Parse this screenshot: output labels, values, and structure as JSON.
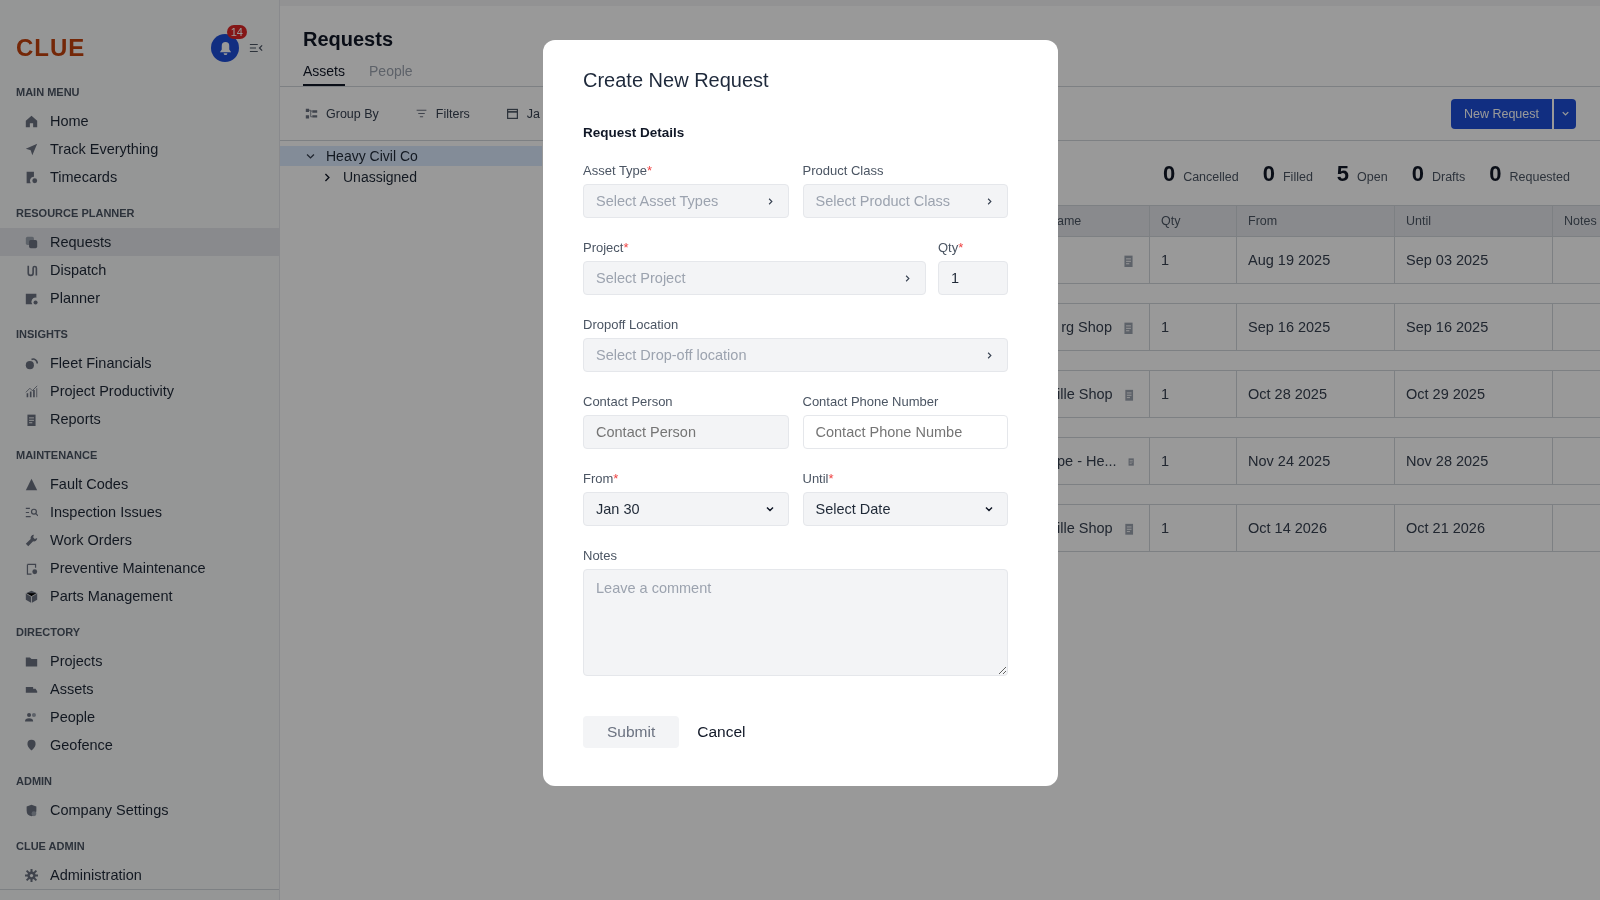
{
  "sidebar": {
    "logo": "CLUE",
    "notification_count": "14",
    "sections": [
      {
        "heading": "MAIN MENU",
        "items": [
          {
            "label": "Home",
            "selected": false
          },
          {
            "label": "Track Everything",
            "selected": false
          },
          {
            "label": "Timecards",
            "selected": false
          }
        ]
      },
      {
        "heading": "RESOURCE PLANNER",
        "items": [
          {
            "label": "Requests",
            "selected": true
          },
          {
            "label": "Dispatch",
            "selected": false
          },
          {
            "label": "Planner",
            "selected": false
          }
        ]
      },
      {
        "heading": "INSIGHTS",
        "items": [
          {
            "label": "Fleet Financials",
            "selected": false
          },
          {
            "label": "Project Productivity",
            "selected": false
          },
          {
            "label": "Reports",
            "selected": false
          }
        ]
      },
      {
        "heading": "MAINTENANCE",
        "items": [
          {
            "label": "Fault Codes",
            "selected": false
          },
          {
            "label": "Inspection Issues",
            "selected": false
          },
          {
            "label": "Work Orders",
            "selected": false
          },
          {
            "label": "Preventive Maintenance",
            "selected": false
          },
          {
            "label": "Parts Management",
            "selected": false
          }
        ]
      },
      {
        "heading": "DIRECTORY",
        "items": [
          {
            "label": "Projects",
            "selected": false
          },
          {
            "label": "Assets",
            "selected": false
          },
          {
            "label": "People",
            "selected": false
          },
          {
            "label": "Geofence",
            "selected": false
          }
        ]
      },
      {
        "heading": "ADMIN",
        "items": [
          {
            "label": "Company Settings",
            "selected": false
          }
        ]
      },
      {
        "heading": "CLUE ADMIN",
        "items": [
          {
            "label": "Administration",
            "selected": false
          }
        ]
      }
    ]
  },
  "page": {
    "title": "Requests",
    "tabs": [
      {
        "label": "Assets",
        "selected": true
      },
      {
        "label": "People",
        "selected": false
      }
    ],
    "toolbar": [
      "Group By",
      "Filters",
      "Ja"
    ],
    "primary_button": "New Request",
    "tree": [
      {
        "label": "Heavy Civil Co",
        "expanded": true,
        "children": [
          {
            "label": "Unassigned",
            "expanded": false
          }
        ]
      }
    ],
    "stats": [
      {
        "count": "0",
        "label": "Cancelled"
      },
      {
        "count": "0",
        "label": "Filled"
      },
      {
        "count": "5",
        "label": "Open"
      },
      {
        "count": "0",
        "label": "Drafts"
      },
      {
        "count": "0",
        "label": "Requested"
      }
    ],
    "table": {
      "columns": [
        "ame",
        "Qty",
        "From",
        "Until",
        "Notes"
      ],
      "rows": [
        {
          "qty": "1",
          "from": "Aug 19 2025",
          "until": "Sep 03 2025"
        },
        {
          "name": "rg Shop",
          "qty": "1",
          "from": "Sep 16 2025",
          "until": "Sep 16 2025"
        },
        {
          "name": "ille Shop",
          "qty": "1",
          "from": "Oct 28 2025",
          "until": "Oct 29 2025"
        },
        {
          "name": "pe - He...",
          "qty": "1",
          "from": "Nov 24 2025",
          "until": "Nov 28 2025"
        },
        {
          "name": "ille Shop",
          "qty": "1",
          "from": "Oct 14 2026",
          "until": "Oct 21 2026"
        }
      ]
    }
  },
  "modal": {
    "title": "Create New Request",
    "section": "Request Details",
    "rows": [
      [
        {
          "kind": "picker",
          "label": "Asset Type",
          "required_mark": "*",
          "placeholder": "Select Asset Types"
        },
        {
          "kind": "picker",
          "label": "Product Class",
          "placeholder": "Select Product Class"
        }
      ],
      [
        {
          "kind": "picker",
          "label": "Project",
          "required_mark": "*",
          "placeholder": "Select Project"
        },
        {
          "kind": "number",
          "label": "Qty",
          "required_mark": "*",
          "value": "1"
        }
      ],
      [
        {
          "kind": "picker",
          "label": "Dropoff Location",
          "placeholder": "Select Drop-off location"
        }
      ],
      [
        {
          "kind": "text",
          "label": "Contact Person",
          "placeholder": "Contact Person"
        },
        {
          "kind": "text",
          "label": "Contact Phone Number",
          "placeholder": "Contact Phone Numbe"
        }
      ],
      [
        {
          "kind": "select",
          "label": "From",
          "required_mark": "*",
          "value": "Jan 30"
        },
        {
          "kind": "select",
          "label": "Until",
          "required_mark": "*",
          "value": "Select Date"
        }
      ],
      [
        {
          "kind": "textarea",
          "label": "Notes",
          "placeholder": "Leave a comment"
        }
      ]
    ],
    "buttons": [
      {
        "label": "Submit",
        "kind": "filled",
        "disabled": true
      },
      {
        "label": "Cancel",
        "kind": "plain",
        "disabled": false
      }
    ]
  }
}
